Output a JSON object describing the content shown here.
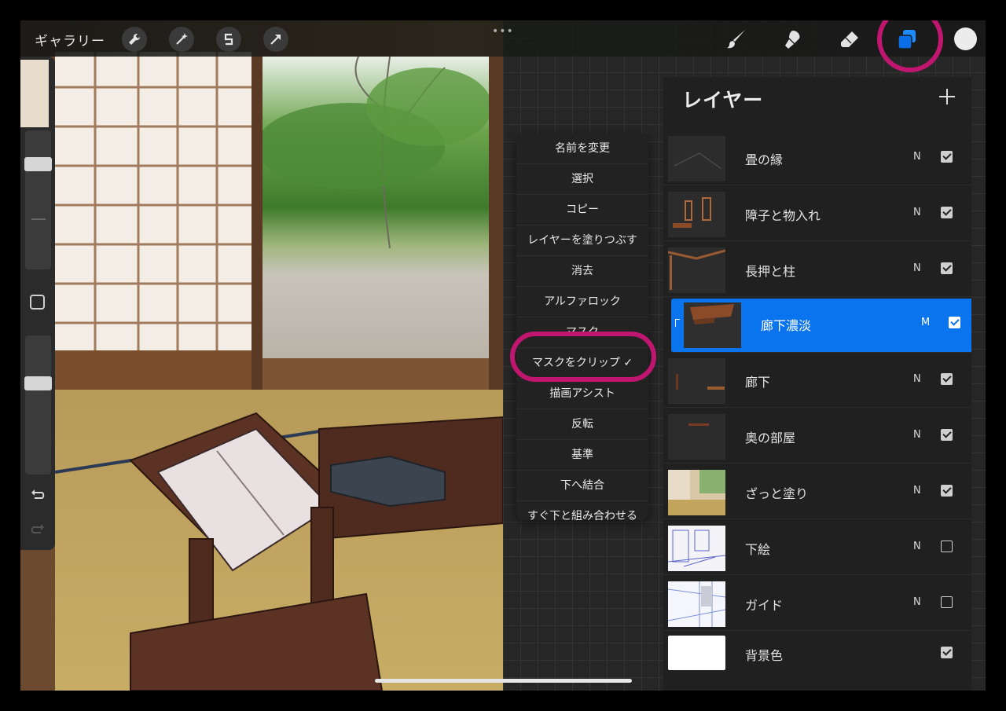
{
  "top_bar": {
    "gallery_label": "ギャラリー",
    "more_dots": "•••"
  },
  "layers_panel": {
    "title": "レイヤー",
    "add_symbol": "+",
    "layers": [
      {
        "name": "畳の縁",
        "blend": "N",
        "visible": true,
        "selected": false
      },
      {
        "name": "障子と物入れ",
        "blend": "N",
        "visible": true,
        "selected": false
      },
      {
        "name": "長押と柱",
        "blend": "N",
        "visible": true,
        "selected": false
      },
      {
        "name": "廊下濃淡",
        "blend": "M",
        "visible": true,
        "selected": true,
        "clipped": true
      },
      {
        "name": "廊下",
        "blend": "N",
        "visible": true,
        "selected": false
      },
      {
        "name": "奥の部屋",
        "blend": "N",
        "visible": true,
        "selected": false
      },
      {
        "name": "ざっと塗り",
        "blend": "N",
        "visible": true,
        "selected": false
      },
      {
        "name": "下絵",
        "blend": "N",
        "visible": false,
        "selected": false
      },
      {
        "name": "ガイド",
        "blend": "N",
        "visible": false,
        "selected": false
      },
      {
        "name": "背景色",
        "blend": "",
        "visible": true,
        "selected": false
      }
    ]
  },
  "layer_menu": {
    "items": [
      "名前を変更",
      "選択",
      "コピー",
      "レイヤーを塗りつぶす",
      "消去",
      "アルファロック",
      "マスク",
      "マスクをクリップ ✓",
      "描画アシスト",
      "反転",
      "基準",
      "下へ結合",
      "すぐ下と組み合わせる"
    ]
  },
  "colors": {
    "accent_blue": "#0a73ee",
    "highlight_magenta": "#c0166f",
    "current_color": "#ececec"
  },
  "icons": {
    "actions": "wrench-icon",
    "adjustments": "magic-wand-icon",
    "selection": "selection-s-icon",
    "transform": "arrow-cursor-icon",
    "brush": "brush-icon",
    "smudge": "smudge-icon",
    "eraser": "eraser-icon",
    "layers": "layers-icon",
    "undo": "undo-icon",
    "redo": "redo-icon"
  }
}
